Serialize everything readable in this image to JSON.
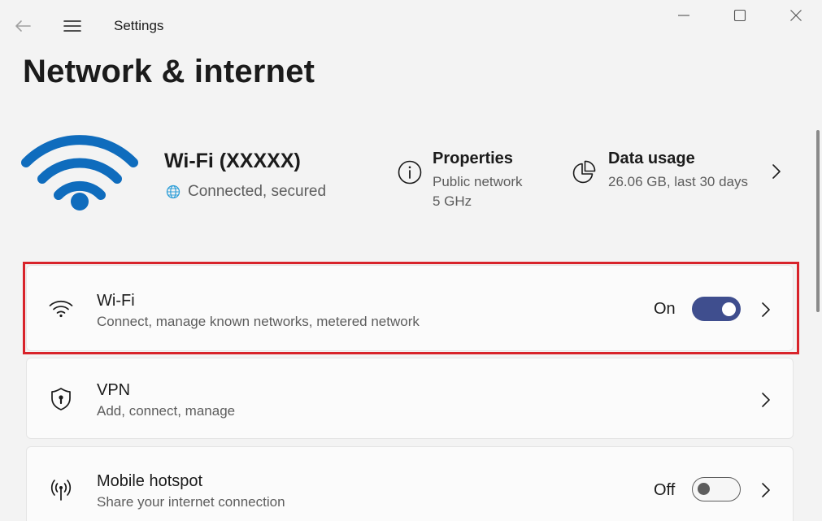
{
  "window": {
    "app_title": "Settings"
  },
  "page": {
    "title": "Network & internet"
  },
  "status": {
    "network_name": "Wi-Fi (XXXXX)",
    "connection_state": "Connected, secured",
    "properties": {
      "title": "Properties",
      "line1": "Public network",
      "line2": "5 GHz"
    },
    "data_usage": {
      "title": "Data usage",
      "detail": "26.06 GB, last 30 days"
    }
  },
  "items": [
    {
      "title": "Wi-Fi",
      "description": "Connect, manage known networks, metered network",
      "toggle_label": "On",
      "toggle_state": "on"
    },
    {
      "title": "VPN",
      "description": "Add, connect, manage"
    },
    {
      "title": "Mobile hotspot",
      "description": "Share your internet connection",
      "toggle_label": "Off",
      "toggle_state": "off"
    }
  ],
  "colors": {
    "accent": "#3f4e8e",
    "hero_wifi": "#0f6cbd",
    "highlight": "#d8232a"
  },
  "icons": [
    "back-arrow-icon",
    "hamburger-menu-icon",
    "minimize-icon",
    "maximize-icon",
    "close-icon",
    "wifi-icon",
    "globe-icon",
    "info-icon",
    "pie-chart-icon",
    "chevron-right-icon",
    "shield-icon",
    "hotspot-icon"
  ]
}
